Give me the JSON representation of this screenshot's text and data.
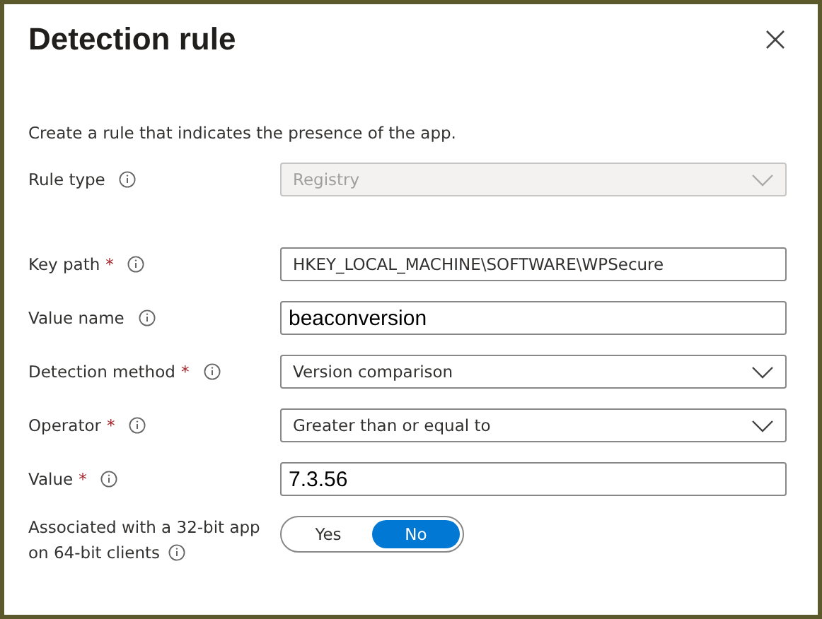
{
  "panel": {
    "title": "Detection rule",
    "description": "Create a rule that indicates the presence of the app."
  },
  "fields": [
    {
      "kind": "dropdown",
      "label": "Rule type",
      "disabled": true,
      "value": "Registry"
    },
    {
      "kind": "text",
      "label": "Key path",
      "required_mark": "*",
      "disabled": false,
      "value": "HKEY_LOCAL_MACHINE\\SOFTWARE\\WPSecure"
    },
    {
      "kind": "text",
      "label": "Value name",
      "disabled": false,
      "value": "beaconversion"
    },
    {
      "kind": "dropdown",
      "label": "Detection method",
      "required_mark": "*",
      "disabled": false,
      "value": "Version comparison"
    },
    {
      "kind": "dropdown",
      "label": "Operator",
      "required_mark": "*",
      "disabled": false,
      "value": "Greater than or equal to"
    },
    {
      "kind": "text",
      "label": "Value",
      "required_mark": "*",
      "disabled": false,
      "value": "7.3.56"
    }
  ],
  "toggle": {
    "label_lines": [
      "Associated with a 32-bit app",
      "on 64-bit clients"
    ],
    "options": [
      {
        "label": "Yes",
        "selected": false
      },
      {
        "label": "No",
        "selected": true
      }
    ]
  }
}
